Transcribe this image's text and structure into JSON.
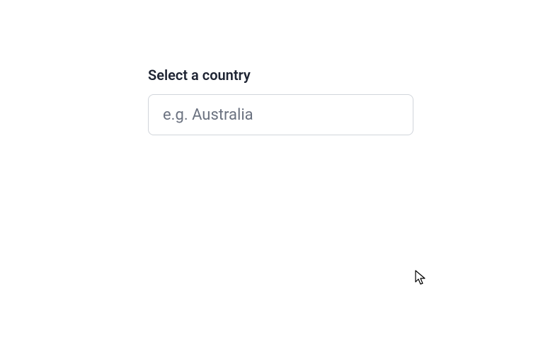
{
  "form": {
    "label": "Select a country",
    "placeholder": "e.g. Australia",
    "value": ""
  }
}
